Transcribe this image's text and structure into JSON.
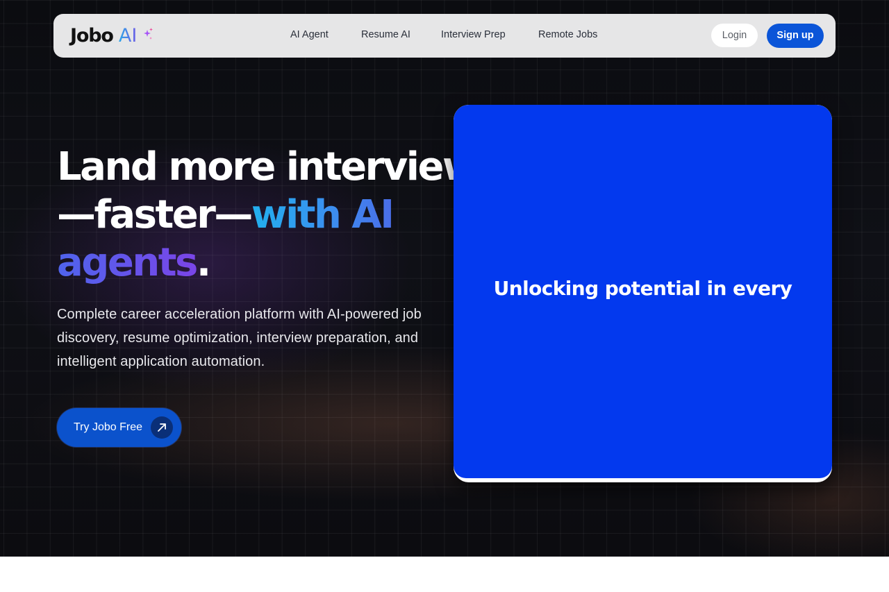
{
  "brand": {
    "name": "Jobo",
    "suffix": "AI"
  },
  "nav": {
    "links": [
      {
        "label": "AI Agent"
      },
      {
        "label": "Resume AI"
      },
      {
        "label": "Interview Prep"
      },
      {
        "label": "Remote Jobs"
      }
    ],
    "login_label": "Login",
    "signup_label": "Sign up"
  },
  "hero": {
    "headline_line1": "Land more interviews",
    "headline_line2_plain": "—faster—",
    "headline_line2_gradient": "with AI",
    "headline_line3_gradient": "agents",
    "headline_line3_period": ".",
    "subtext": "Complete career acceleration platform with AI-powered job discovery, resume optimization, interview preparation, and intelligent application automation.",
    "cta_label": "Try Jobo Free"
  },
  "video": {
    "caption": "Unlocking potential in  every"
  },
  "colors": {
    "accent_blue": "#0b55d8",
    "video_blue": "#0339ee",
    "gradient_cyan": "#22b0ee",
    "gradient_purple": "#7a45e8"
  },
  "icons": {
    "logo_sparkle": "sparkle-icon",
    "cta_arrow": "arrow-up-right-icon"
  }
}
